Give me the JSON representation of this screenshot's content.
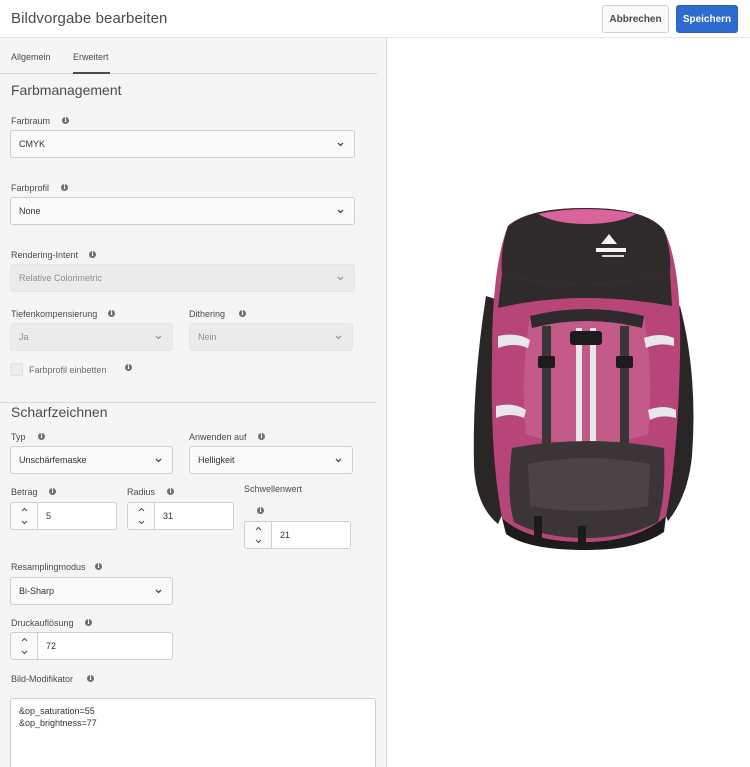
{
  "header": {
    "title": "Bildvorgabe bearbeiten",
    "cancel_label": "Abbrechen",
    "save_label": "Speichern"
  },
  "tabs": [
    {
      "label": "Allgemein",
      "active": false
    },
    {
      "label": "Erweitert",
      "active": true
    }
  ],
  "color_management": {
    "title": "Farbmanagement",
    "color_space": {
      "label": "Farbraum",
      "value": "CMYK"
    },
    "color_profile": {
      "label": "Farbprofil",
      "value": "None"
    },
    "rendering_intent": {
      "label": "Rendering-Intent",
      "value": "Relative Colorimetric",
      "disabled": true
    },
    "depth_compensation": {
      "label": "Tiefenkompensierung",
      "value": "Ja",
      "disabled": true
    },
    "dithering": {
      "label": "Dithering",
      "value": "Nein",
      "disabled": true
    },
    "embed_profile": {
      "label": "Farbprofil einbetten",
      "checked": false,
      "disabled": true
    }
  },
  "sharpening": {
    "title": "Scharfzeichnen",
    "type": {
      "label": "Typ",
      "value": "Unschärfemaske"
    },
    "apply_to": {
      "label": "Anwenden auf",
      "value": "Helligkeit"
    },
    "amount": {
      "label": "Betrag",
      "value": "5"
    },
    "radius": {
      "label": "Radius",
      "value": "31"
    },
    "threshold": {
      "label": "Schwellenwert",
      "value": "21"
    },
    "resampling": {
      "label": "Resamplingmodus",
      "value": "Bi-Sharp"
    },
    "print_resolution": {
      "label": "Druckauflösung",
      "value": "72"
    },
    "modifier": {
      "label": "Bild-Modifikator",
      "lines": [
        "&op_saturation=55",
        "&op_brightness=77"
      ]
    }
  },
  "preview": {
    "image": "backpack-product-image"
  },
  "colors": {
    "primary": "#2d6bcf",
    "panel": "#f5f5f5"
  }
}
